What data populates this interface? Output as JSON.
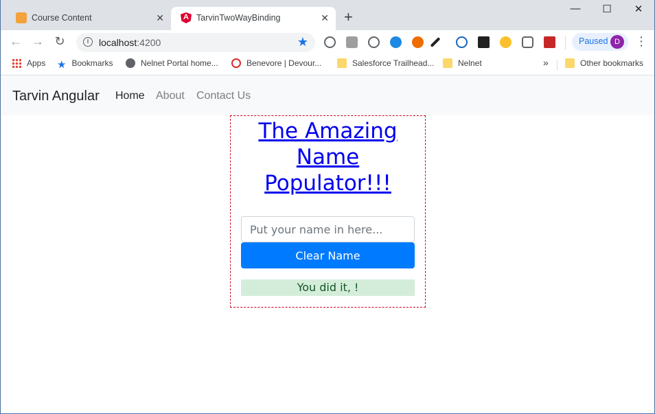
{
  "browser": {
    "tabs": [
      {
        "title": "Course Content",
        "active": false
      },
      {
        "title": "TarvinTwoWayBinding",
        "active": true
      }
    ],
    "new_tab_symbol": "+",
    "address": {
      "host": "localhost",
      "port": ":4200"
    },
    "profile": {
      "status": "Paused",
      "initial": "D"
    },
    "window_controls": {
      "minimize": "—",
      "maximize": "☐",
      "close": "✕"
    },
    "bookmarks": [
      {
        "label": "Apps",
        "icon": "apps-grid-icon"
      },
      {
        "label": "Bookmarks",
        "icon": "star-icon"
      },
      {
        "label": "Nelnet Portal home...",
        "icon": "globe-icon"
      },
      {
        "label": "Benevore | Devour...",
        "icon": "benevore-icon"
      },
      {
        "label": "Salesforce Trailhead...",
        "icon": "folder-icon"
      },
      {
        "label": "Nelnet",
        "icon": "folder-icon"
      }
    ],
    "overflow": "»",
    "other_bookmarks": "Other bookmarks"
  },
  "app": {
    "brand": "Tarvin Angular",
    "nav": [
      {
        "label": "Home",
        "active": true
      },
      {
        "label": "About",
        "active": false
      },
      {
        "label": "Contact Us",
        "active": false
      }
    ],
    "heading": "The Amazing Name Populator!!!",
    "input": {
      "placeholder": "Put your name in here...",
      "value": ""
    },
    "clear_button": "Clear Name",
    "message": "You did it, !"
  },
  "colors": {
    "primary": "#007bff",
    "success_bg": "#d4edda",
    "success_text": "#155724",
    "panel_border": "#d0021b"
  }
}
